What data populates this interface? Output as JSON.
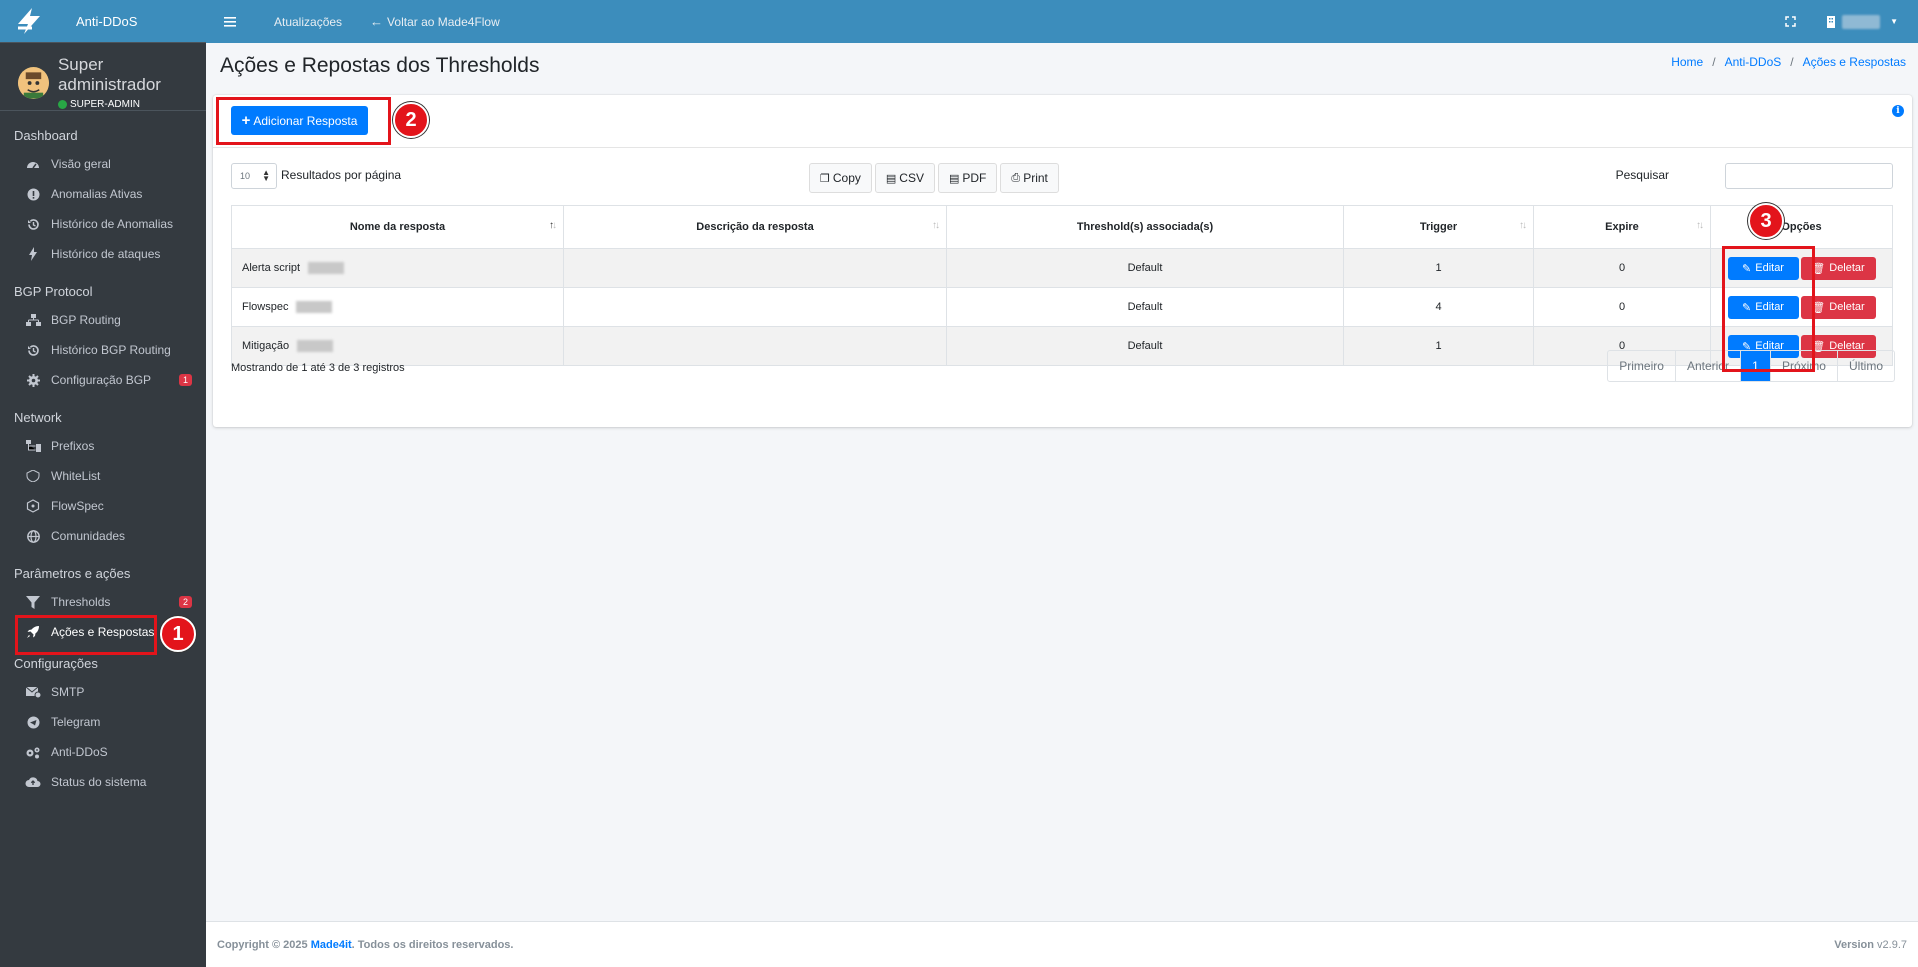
{
  "brand": {
    "name": "Anti-DDoS"
  },
  "user": {
    "name": "Super administrador",
    "role": "SUPER-ADMIN"
  },
  "sidebar": {
    "sections": [
      {
        "header": "Dashboard",
        "items": [
          {
            "label": "Visão geral",
            "icon": "gauge-icon"
          },
          {
            "label": "Anomalias Ativas",
            "icon": "exclamation-circle-icon"
          },
          {
            "label": "Histórico de Anomalias",
            "icon": "history-icon"
          },
          {
            "label": "Histórico de ataques",
            "icon": "bolt-icon"
          }
        ]
      },
      {
        "header": "BGP Protocol",
        "items": [
          {
            "label": "BGP Routing",
            "icon": "network-icon"
          },
          {
            "label": "Histórico BGP Routing",
            "icon": "history-icon"
          },
          {
            "label": "Configuração BGP",
            "icon": "gear-icon",
            "badge": "1"
          }
        ]
      },
      {
        "header": "Network",
        "items": [
          {
            "label": "Prefixos",
            "icon": "sitemap-icon"
          },
          {
            "label": "WhiteList",
            "icon": "shield-icon"
          },
          {
            "label": "FlowSpec",
            "icon": "hexagon-icon"
          },
          {
            "label": "Comunidades",
            "icon": "globe-icon"
          }
        ]
      },
      {
        "header": "Parâmetros e ações",
        "items": [
          {
            "label": "Thresholds",
            "icon": "filter-icon",
            "badge": "2"
          },
          {
            "label": "Ações e Respostas",
            "icon": "rocket-icon",
            "active": true
          }
        ]
      },
      {
        "header": "Configurações",
        "items": [
          {
            "label": "SMTP",
            "icon": "mail-icon"
          },
          {
            "label": "Telegram",
            "icon": "telegram-icon"
          },
          {
            "label": "Anti-DDoS",
            "icon": "gears-icon"
          },
          {
            "label": "Status do sistema",
            "icon": "cloud-upload-icon"
          }
        ]
      }
    ]
  },
  "topbar": {
    "updates": "Atualizações",
    "back": "Voltar ao Made4Flow"
  },
  "page": {
    "title": "Ações e Repostas dos Thresholds",
    "breadcrumb": [
      "Home",
      "Anti-DDoS",
      "Ações e Respostas"
    ]
  },
  "card": {
    "add_button": "Adicionar Resposta",
    "page_length": "10",
    "page_length_label": "Resultados por página",
    "export": [
      "Copy",
      "CSV",
      "PDF",
      "Print"
    ],
    "search_label": "Pesquisar",
    "search_value": "",
    "columns": [
      "Nome da resposta",
      "Descrição da resposta",
      "Threshold(s) associada(s)",
      "Trigger",
      "Expire",
      "Opções"
    ],
    "rows": [
      {
        "name": "Alerta script",
        "description": "",
        "threshold": "Default",
        "trigger": "1",
        "expire": "0"
      },
      {
        "name": "Flowspec",
        "description": "",
        "threshold": "Default",
        "trigger": "4",
        "expire": "0"
      },
      {
        "name": "Mitigação",
        "description": "",
        "threshold": "Default",
        "trigger": "1",
        "expire": "0"
      }
    ],
    "edit_label": "Editar",
    "delete_label": "Deletar",
    "info": "Mostrando de 1 até 3 de 3 registros",
    "pager": {
      "first": "Primeiro",
      "prev": "Anterior",
      "current": "1",
      "next": "Próximo",
      "last": "Último"
    }
  },
  "annotations": {
    "step1": "1",
    "step2": "2",
    "step3": "3"
  },
  "footer": {
    "copyright": "Copyright © 2025",
    "company": "Made4it",
    "rights": ". Todos os direitos reservados.",
    "version_label": "Version",
    "version": "v2.9.7"
  },
  "colors": {
    "topbar": "#3c8dbc",
    "sidebar": "#343a40",
    "primary": "#007bff",
    "danger": "#dc3545",
    "annotation": "#e3141b"
  }
}
